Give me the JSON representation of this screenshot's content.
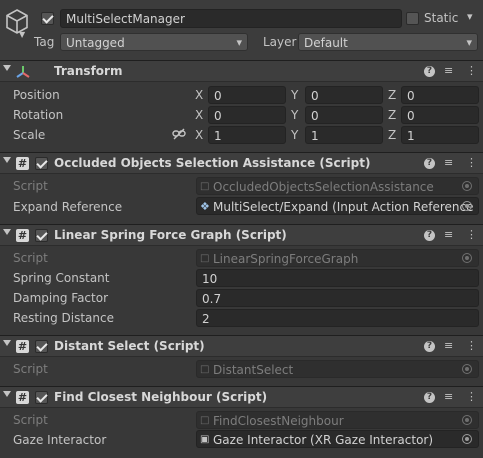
{
  "object": {
    "name": "MultiSelectManager",
    "active": true,
    "static_label": "Static",
    "static": false,
    "tag_label": "Tag",
    "tag_value": "Untagged",
    "layer_label": "Layer",
    "layer_value": "Default"
  },
  "transform": {
    "title": "Transform",
    "rows": [
      {
        "label": "Position",
        "x": "0",
        "y": "0",
        "z": "0"
      },
      {
        "label": "Rotation",
        "x": "0",
        "y": "0",
        "z": "0"
      },
      {
        "label": "Scale",
        "x": "1",
        "y": "1",
        "z": "1"
      }
    ],
    "axes": [
      "X",
      "Y",
      "Z"
    ]
  },
  "components": [
    {
      "title": "Occluded Objects Selection Assistance (Script)",
      "enabled": true,
      "script_label": "Script",
      "script_value": "OccludedObjectsSelectionAssistance",
      "fields": [
        {
          "label": "Expand Reference",
          "value": "MultiSelect/Expand (Input Action Reference"
        }
      ]
    },
    {
      "title": "Linear Spring Force Graph (Script)",
      "enabled": true,
      "script_label": "Script",
      "script_value": "LinearSpringForceGraph",
      "fields": [
        {
          "label": "Spring Constant",
          "value": "10"
        },
        {
          "label": "Damping Factor",
          "value": "0.7"
        },
        {
          "label": "Resting Distance",
          "value": "2"
        }
      ]
    },
    {
      "title": "Distant Select (Script)",
      "enabled": true,
      "script_label": "Script",
      "script_value": "DistantSelect",
      "fields": []
    },
    {
      "title": "Find Closest Neighbour (Script)",
      "enabled": true,
      "script_label": "Script",
      "script_value": "FindClosestNeighbour",
      "fields": [
        {
          "label": "Gaze Interactor",
          "value": "Gaze Interactor (XR Gaze Interactor)"
        }
      ]
    }
  ],
  "icons": {
    "gameobject": "cube-icon",
    "transform": "transform-axes-icon",
    "script": "script-hash-icon",
    "help": "help-icon",
    "presets": "presets-sliders-icon",
    "menu": "kebab-menu-icon",
    "scale_link": "link-icon",
    "object_picker": "target-icon",
    "input_action": "input-action-icon",
    "fold": "foldout-arrow-icon"
  }
}
